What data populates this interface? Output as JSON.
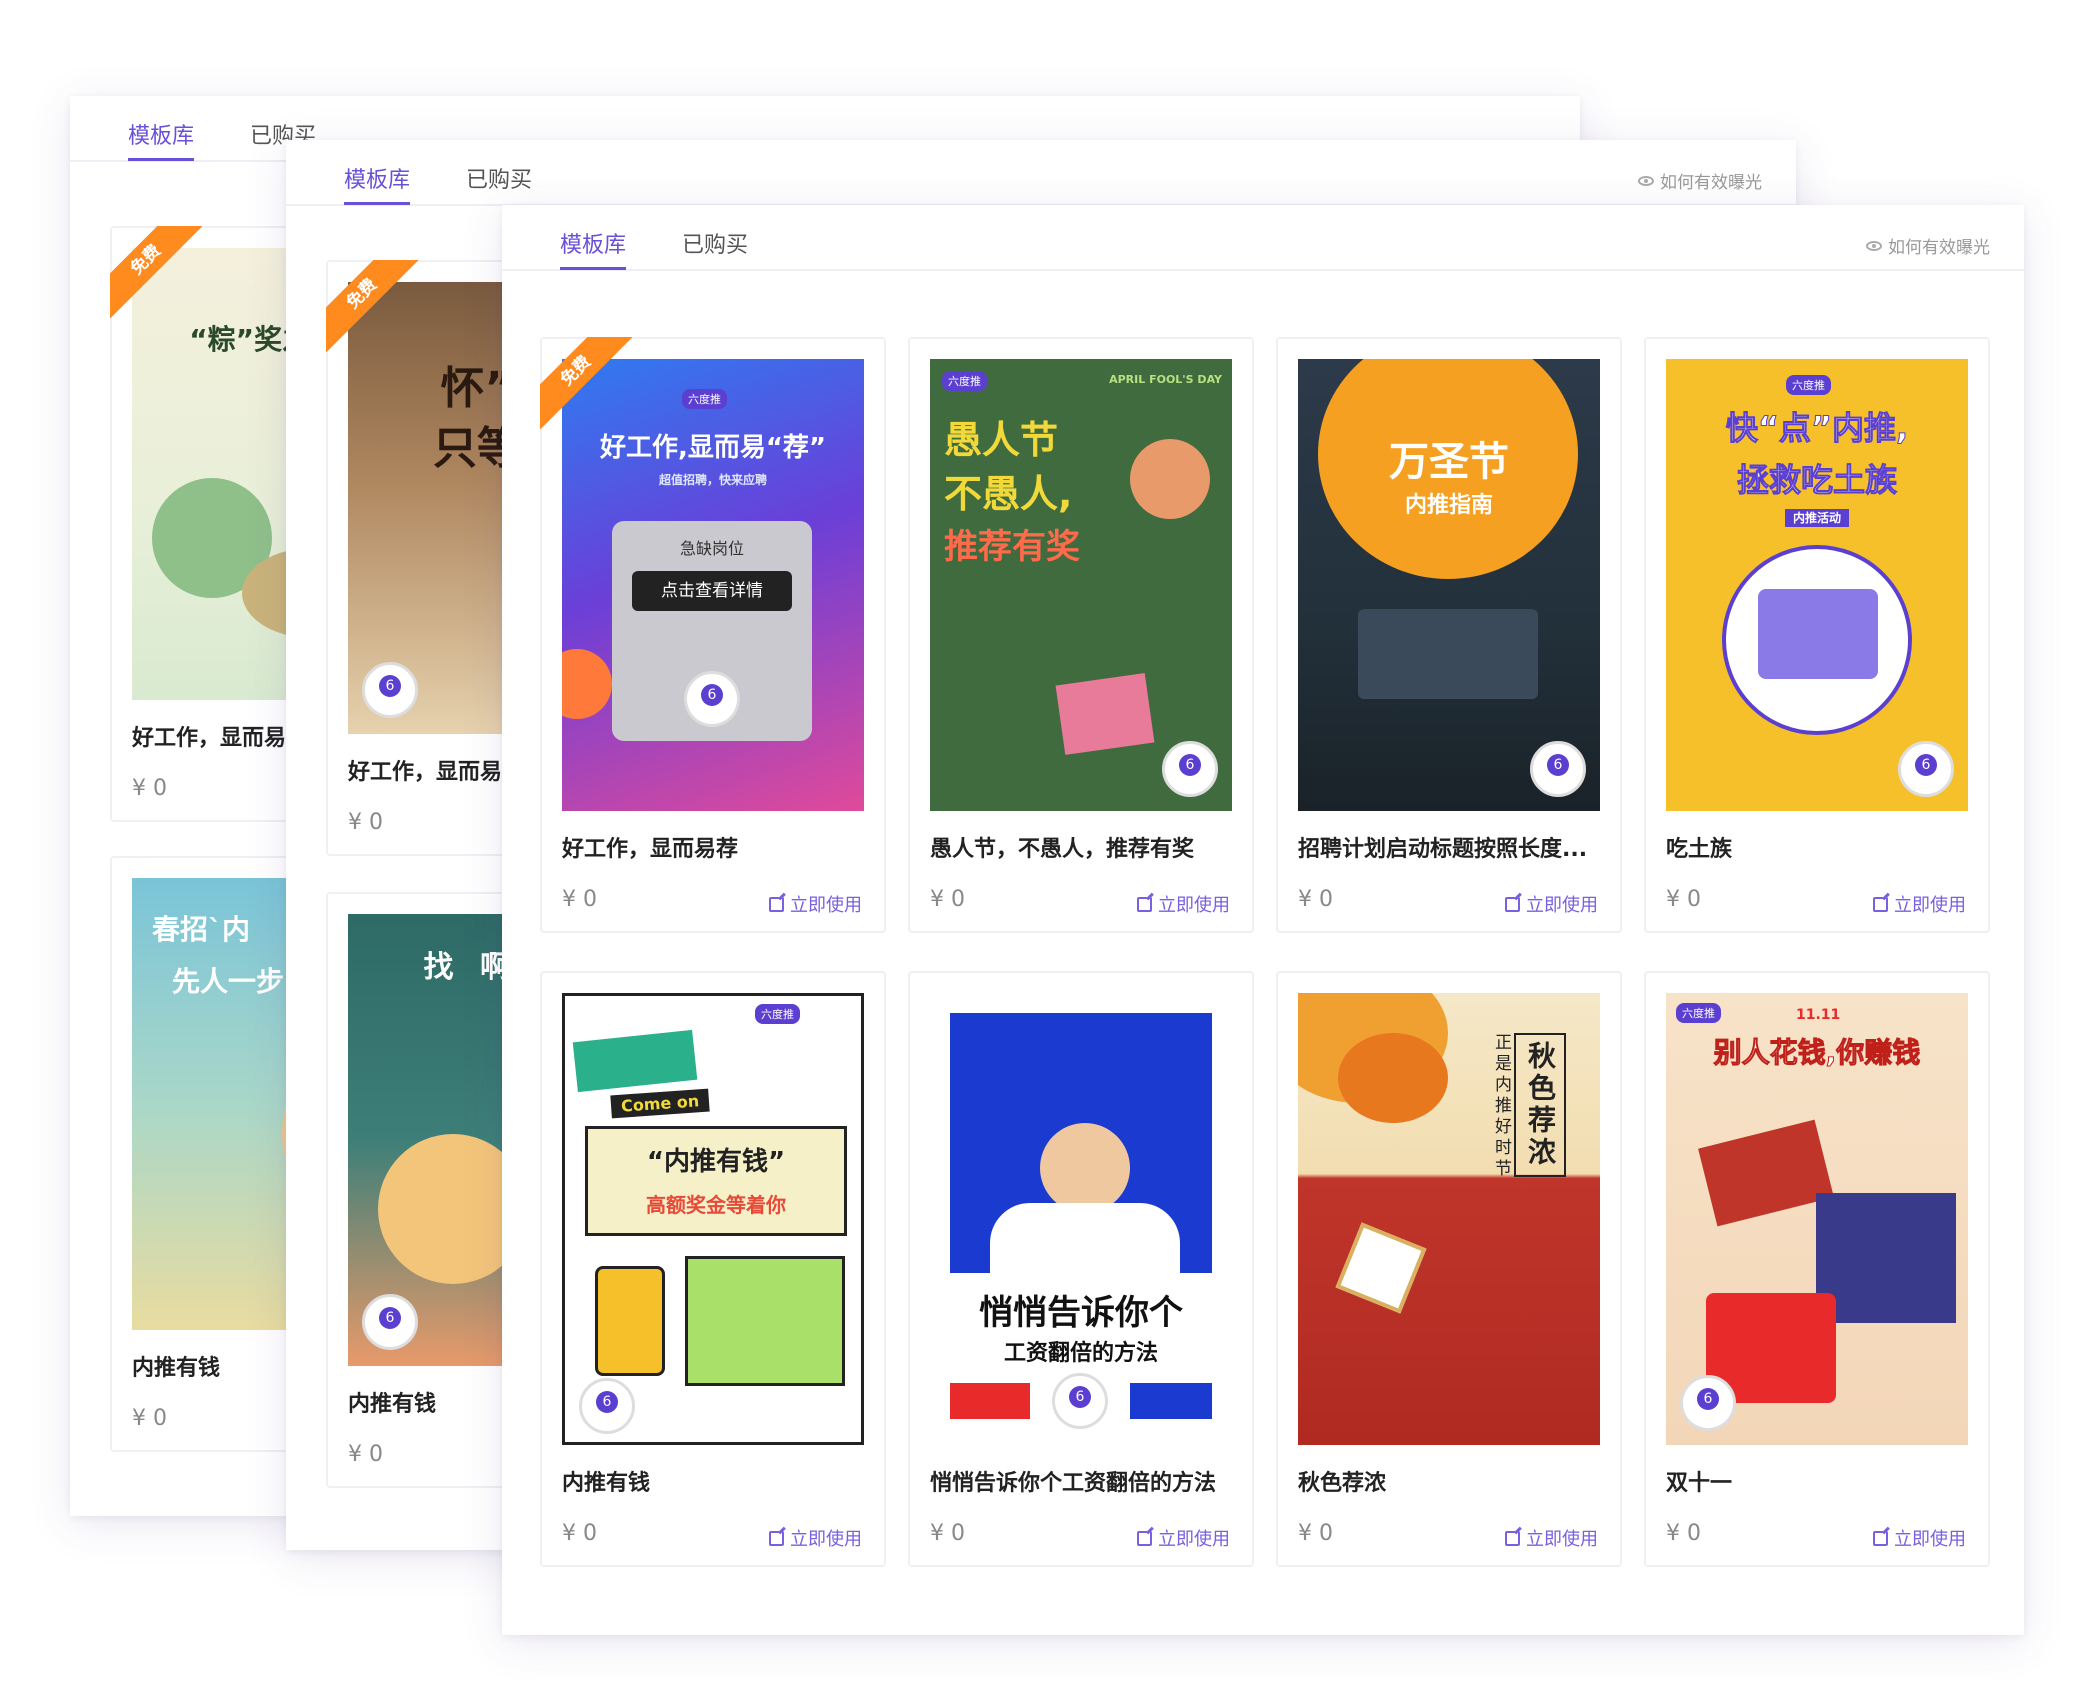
{
  "tabs": {
    "library": "模板库",
    "purchased": "已购买",
    "purchased_cut": "已购买"
  },
  "hint": "如何有效曝光",
  "use_label": "立即使用",
  "free_badge": "免费",
  "brand": "六度推",
  "cards": [
    {
      "title": "好工作，显而易荐",
      "price": "¥ 0"
    },
    {
      "title": "愚人节，不愚人，推荐有奖",
      "price": "¥ 0"
    },
    {
      "title": "招聘计划启动标题按照长度...",
      "price": "¥ 0"
    },
    {
      "title": "吃土族",
      "price": "¥ 0"
    },
    {
      "title": "内推有钱",
      "price": "¥ 0"
    },
    {
      "title": "悄悄告诉你个工资翻倍的方法",
      "price": "¥ 0"
    },
    {
      "title": "秋色荐浓",
      "price": "¥ 0"
    },
    {
      "title": "双十一",
      "price": "¥ 0"
    }
  ],
  "back_cards": [
    {
      "title": "好工作，显而易荐",
      "price": "¥ 0"
    },
    {
      "title": "内推有钱",
      "price": "¥ 0"
    }
  ],
  "posters": {
    "p1": {
      "headline": "好工作,显而易“荐”",
      "sub": "超值招聘，快来应聘",
      "box_title": "急缺岗位",
      "button": "点击查看详情"
    },
    "p2": {
      "line1": "愚人节",
      "line2": "不愚人,",
      "line3": "推荐有奖",
      "tag": "APRIL FOOL'S DAY"
    },
    "p3": {
      "line1": "万圣节",
      "line2": "内推指南"
    },
    "p4": {
      "line1": "快“点”内推,",
      "line2": "拯救吃土族",
      "tag": "内推活动"
    },
    "p5": {
      "line1": "“内推有钱”",
      "line2": "高额奖金等着你",
      "tag": "Come on"
    },
    "p6": {
      "line1": "悄悄告诉你个",
      "line2": "工资翻倍的方法"
    },
    "p7": {
      "line1": "秋色荐浓",
      "line2": "正是内推好时节"
    },
    "p8": {
      "line1": "别人花钱,你赚钱",
      "tag": "11.11"
    },
    "b1": {
      "line1": "“粽”奖之下,内"
    },
    "b2": {
      "line1": "春招`内",
      "line2": "先人一步"
    },
    "b3": {
      "line1": "怀”财",
      "line2": "只等你"
    },
    "b4": {
      "line1": "找 啊 找"
    }
  },
  "colors": {
    "accent": "#6a4fd8",
    "badge": "#ff8a1e"
  }
}
